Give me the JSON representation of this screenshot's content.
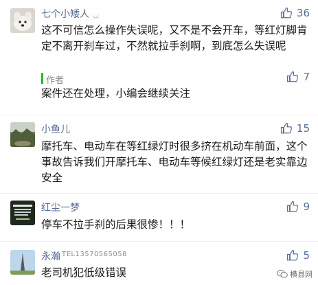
{
  "colors": {
    "name_link": "#576b95",
    "body_text": "#1a1a1a",
    "author_accent": "#2bb32b",
    "meta_gray": "#8a8a8a"
  },
  "comments": [
    {
      "name": "七个小矮人",
      "name_suffix_icon": "smile-icon",
      "likes": "36",
      "text": "这不可信怎么操作失误呢，又不是不会开车，等红灯脚肯定不离开刹车过，不然就拉手刹啊，到底怎么失误呢",
      "reply": {
        "author_label": "作者",
        "likes": "7",
        "text": "案件还在处理，小编会继续关注"
      }
    },
    {
      "name": "小鱼儿",
      "likes": "15",
      "text": "摩托车、电动车在等红绿灯时很多挤在机动车前面，这个事故告诉我们开摩托车、电动车等候红绿灯还是老实靠边安全"
    },
    {
      "name": "红尘一梦",
      "likes": "9",
      "text": "停车不拉手刹的后果很惨！！！"
    },
    {
      "name": "永瀚",
      "name_phone": "TEL13570565058",
      "likes": "5",
      "text": "老司机犯低级错误"
    }
  ],
  "watermark": {
    "text": "横县网",
    "icon": "wechat-icon"
  }
}
